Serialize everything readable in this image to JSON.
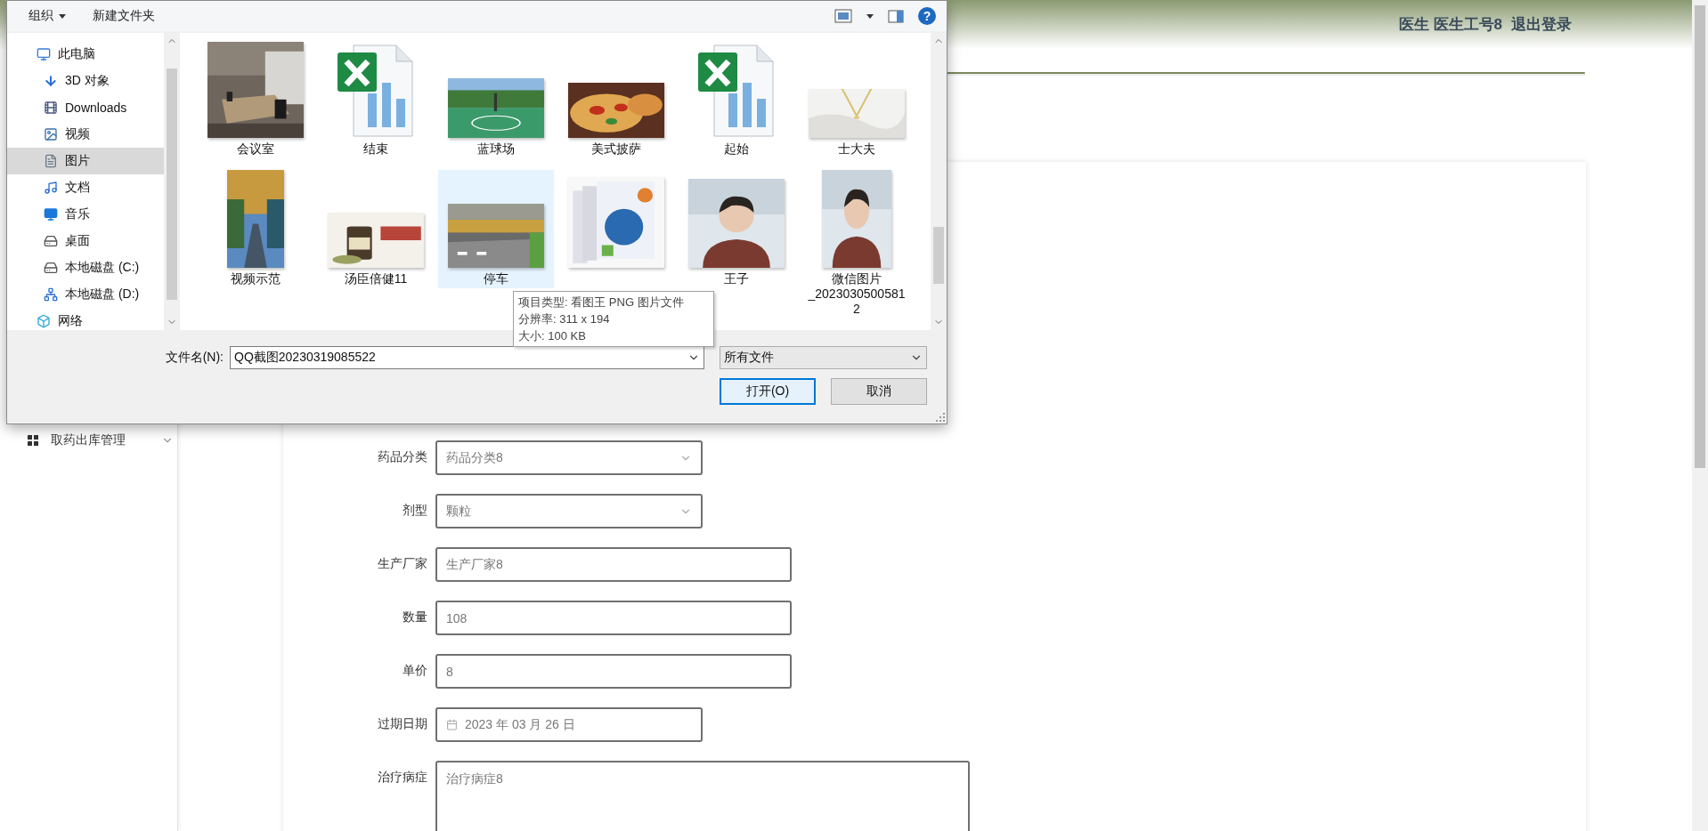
{
  "header": {
    "user": "医生 医生工号8",
    "logout": "退出登录"
  },
  "sidebar": {
    "items": [
      {
        "label": "取药出库管理",
        "expanded": false
      }
    ]
  },
  "form": {
    "fields": [
      {
        "kind": "select",
        "label": "药品分类",
        "value": "药品分类8"
      },
      {
        "kind": "select",
        "label": "剂型",
        "value": "颗粒"
      },
      {
        "kind": "text",
        "label": "生产厂家",
        "value": "生产厂家8"
      },
      {
        "kind": "text",
        "label": "数量",
        "value": "108"
      },
      {
        "kind": "text",
        "label": "单价",
        "value": "8"
      },
      {
        "kind": "date",
        "label": "过期日期",
        "value": "2023 年 03 月 26 日"
      },
      {
        "kind": "textarea",
        "label": "治疗病症",
        "value": "治疗病症8"
      }
    ]
  },
  "dialog": {
    "toolbar": {
      "organize": "组织",
      "new_folder": "新建文件夹",
      "help": "?"
    },
    "nav": [
      {
        "label": "此电脑",
        "selected": false,
        "children": [
          {
            "label": "3D 对象",
            "selected": false
          },
          {
            "label": "Downloads",
            "selected": false
          },
          {
            "label": "视频",
            "selected": false
          },
          {
            "label": "图片",
            "selected": true
          },
          {
            "label": "文档",
            "selected": false
          },
          {
            "label": "音乐",
            "selected": false
          },
          {
            "label": "桌面",
            "selected": false
          },
          {
            "label": "本地磁盘 (C:)",
            "selected": false
          },
          {
            "label": "本地磁盘 (D:)",
            "selected": false
          }
        ]
      },
      {
        "label": "网络",
        "selected": false
      }
    ],
    "files": [
      {
        "label": "会议室",
        "kind": "picture",
        "selected": false
      },
      {
        "label": "结束",
        "kind": "spreadsheet",
        "selected": false
      },
      {
        "label": "蓝球场",
        "kind": "picture",
        "selected": false
      },
      {
        "label": "美式披萨",
        "kind": "picture",
        "selected": false
      },
      {
        "label": "起始",
        "kind": "spreadsheet",
        "selected": false
      },
      {
        "label": "士大夫",
        "kind": "picture",
        "selected": false
      },
      {
        "label": "视频示范",
        "kind": "picture",
        "selected": false
      },
      {
        "label": "汤臣倍健11",
        "kind": "picture",
        "selected": false
      },
      {
        "label": "停车",
        "kind": "picture",
        "selected": true
      },
      {
        "kind": "picture",
        "selected": false
      },
      {
        "label": "王子",
        "kind": "picture",
        "selected": false
      },
      {
        "label": "微信图片_20230305005812",
        "kind": "picture",
        "selected": false
      }
    ],
    "tooltip": {
      "lines": [
        "项目类型: 看图王 PNG 图片文件",
        "分辨率: 311 x 194",
        "大小: 100 KB"
      ]
    },
    "filename": {
      "label": "文件名(N):",
      "value": "QQ截图20230319085522"
    },
    "file_type": "所有文件",
    "buttons": [
      {
        "label": "打开(O)",
        "default": true
      },
      {
        "label": "取消",
        "default": false
      }
    ]
  }
}
